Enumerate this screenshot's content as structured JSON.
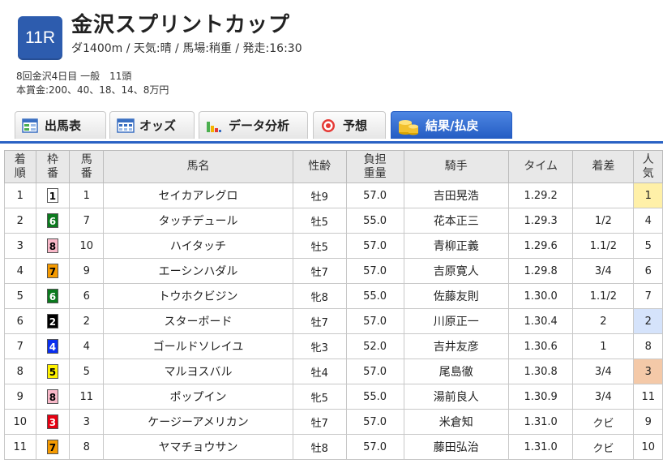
{
  "race": {
    "number": "11R",
    "title": "金沢スプリントカップ",
    "meta": "ダ1400m / 天気:晴 / 馬場:稍重 / 発走:16:30",
    "sub1": "8回金沢4日目 一般　11頭",
    "sub2": "本賞金:200、40、18、14、8万円",
    "badge_color": "#2d5cae"
  },
  "tabs": [
    {
      "label": "出馬表",
      "icon": "table-icon"
    },
    {
      "label": "オッズ",
      "icon": "odds-icon"
    },
    {
      "label": "データ分析",
      "icon": "bar-chart-icon"
    },
    {
      "label": "予想",
      "icon": "target-icon"
    },
    {
      "label": "結果/払戻",
      "icon": "coins-icon",
      "active": true
    }
  ],
  "table": {
    "headers": {
      "rank": "着\n順",
      "waku": "枠\n番",
      "umaban": "馬\n番",
      "name": "馬名",
      "sexage": "性齢",
      "weight": "負担\n重量",
      "jockey": "騎手",
      "time": "タイム",
      "margin": "着差",
      "pop": "人\n気"
    },
    "rows": [
      {
        "rank": "1",
        "waku": "1",
        "umaban": "1",
        "name": "セイカアレグロ",
        "sexage": "牡9",
        "weight": "57.0",
        "jockey": "吉田晃浩",
        "time": "1.29.2",
        "margin": "",
        "pop": "1"
      },
      {
        "rank": "2",
        "waku": "6",
        "umaban": "7",
        "name": "タッチデュール",
        "sexage": "牡5",
        "weight": "55.0",
        "jockey": "花本正三",
        "time": "1.29.3",
        "margin": "1/2",
        "pop": "4"
      },
      {
        "rank": "3",
        "waku": "8",
        "umaban": "10",
        "name": "ハイタッチ",
        "sexage": "牡5",
        "weight": "57.0",
        "jockey": "青柳正義",
        "time": "1.29.6",
        "margin": "1.1/2",
        "pop": "5"
      },
      {
        "rank": "4",
        "waku": "7",
        "umaban": "9",
        "name": "エーシンハダル",
        "sexage": "牡7",
        "weight": "57.0",
        "jockey": "吉原寛人",
        "time": "1.29.8",
        "margin": "3/4",
        "pop": "6"
      },
      {
        "rank": "5",
        "waku": "6",
        "umaban": "6",
        "name": "トウホクビジン",
        "sexage": "牝8",
        "weight": "55.0",
        "jockey": "佐藤友則",
        "time": "1.30.0",
        "margin": "1.1/2",
        "pop": "7"
      },
      {
        "rank": "6",
        "waku": "2",
        "umaban": "2",
        "name": "スターボード",
        "sexage": "牡7",
        "weight": "57.0",
        "jockey": "川原正一",
        "time": "1.30.4",
        "margin": "2",
        "pop": "2"
      },
      {
        "rank": "7",
        "waku": "4",
        "umaban": "4",
        "name": "ゴールドソレイユ",
        "sexage": "牝3",
        "weight": "52.0",
        "jockey": "吉井友彦",
        "time": "1.30.6",
        "margin": "1",
        "pop": "8"
      },
      {
        "rank": "8",
        "waku": "5",
        "umaban": "5",
        "name": "マルヨスバル",
        "sexage": "牡4",
        "weight": "57.0",
        "jockey": "尾島徹",
        "time": "1.30.8",
        "margin": "3/4",
        "pop": "3"
      },
      {
        "rank": "9",
        "waku": "8",
        "umaban": "11",
        "name": "ポップイン",
        "sexage": "牝5",
        "weight": "55.0",
        "jockey": "湯前良人",
        "time": "1.30.9",
        "margin": "3/4",
        "pop": "11"
      },
      {
        "rank": "10",
        "waku": "3",
        "umaban": "3",
        "name": "ケージーアメリカン",
        "sexage": "牡7",
        "weight": "57.0",
        "jockey": "米倉知",
        "time": "1.31.0",
        "margin": "クビ",
        "pop": "9"
      },
      {
        "rank": "11",
        "waku": "7",
        "umaban": "8",
        "name": "ヤマチョウサン",
        "sexage": "牡8",
        "weight": "57.0",
        "jockey": "藤田弘治",
        "time": "1.31.0",
        "margin": "クビ",
        "pop": "10"
      }
    ]
  },
  "waku_colors": {
    "1": {
      "bg": "#ffffff",
      "fg": "#000000"
    },
    "2": {
      "bg": "#000000",
      "fg": "#ffffff"
    },
    "3": {
      "bg": "#e60012",
      "fg": "#ffffff"
    },
    "4": {
      "bg": "#0a2ff0",
      "fg": "#ffffff"
    },
    "5": {
      "bg": "#fff200",
      "fg": "#000000"
    },
    "6": {
      "bg": "#0b7a1e",
      "fg": "#ffffff"
    },
    "7": {
      "bg": "#f59a00",
      "fg": "#000000"
    },
    "8": {
      "bg": "#f8b8c8",
      "fg": "#000000"
    }
  }
}
